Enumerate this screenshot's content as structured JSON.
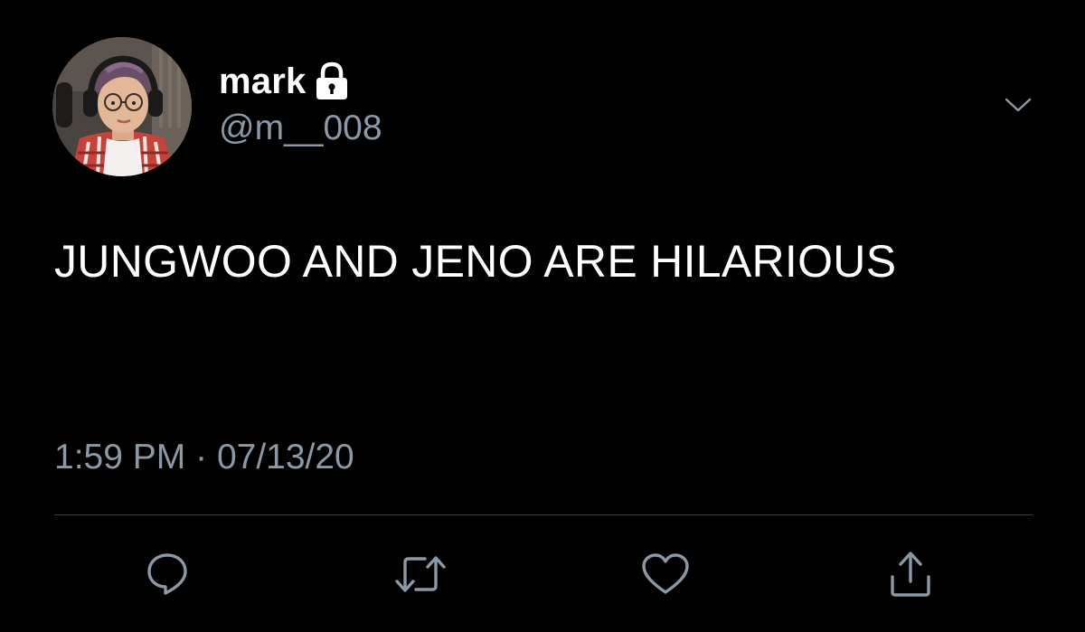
{
  "user": {
    "display_name": "mark",
    "handle": "@m__008",
    "protected_icon": "lock-icon",
    "avatar_icon": "profile-photo"
  },
  "menu": {
    "icon": "chevron-down-icon"
  },
  "tweet": {
    "text": "JUNGWOO AND JENO ARE HILARIOUS",
    "time": "1:59 PM",
    "separator": "·",
    "date": "07/13/20"
  },
  "actions": [
    {
      "icon": "reply-icon"
    },
    {
      "icon": "retweet-icon"
    },
    {
      "icon": "like-icon"
    },
    {
      "icon": "share-icon"
    }
  ],
  "colors": {
    "background": "#000000",
    "text_primary": "#ffffff",
    "text_secondary": "#8b98a5",
    "divider": "#38444d"
  }
}
